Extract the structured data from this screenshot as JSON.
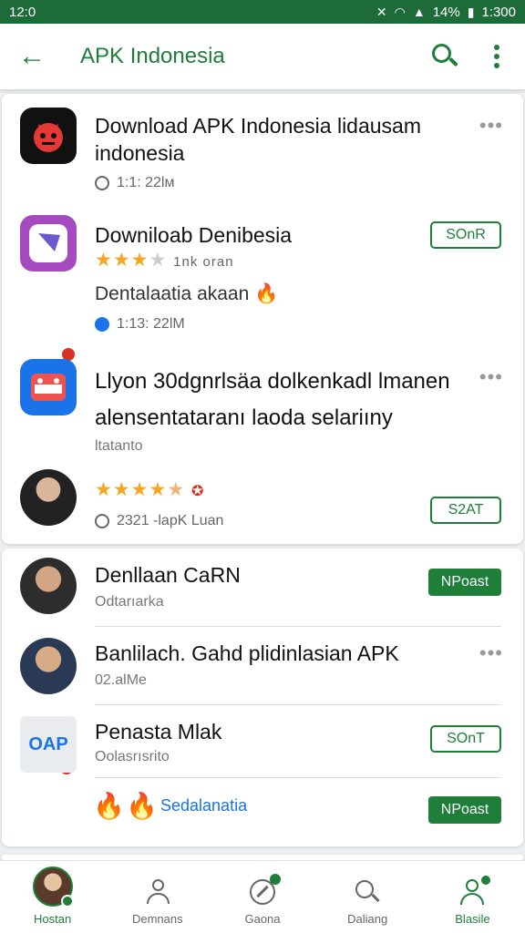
{
  "status_bar": {
    "time": "12:0",
    "battery": "14%",
    "clock_right": "1:300"
  },
  "app_bar": {
    "title": "APK Indonesia"
  },
  "card1": {
    "items": [
      {
        "title": "Download APK Indonesia lidausam indonesia",
        "meta": "1:1:  22lм"
      },
      {
        "title": "Downiloab Denibesia",
        "rating_text": "1nk oran",
        "description": "Dentalaatia akaan",
        "meta": "1:13:  22lM",
        "button": "SOnR"
      },
      {
        "title": "Llyon 30dgnrlsäa dolkenkadl lmanen alensentataranı laoda selariıny",
        "sub": "ltatanto"
      },
      {
        "meta": "2321 -lapK Luan",
        "button": "S2AT"
      }
    ]
  },
  "card2": {
    "items": [
      {
        "title": "Denllaan CaRN",
        "sub": "Odtarıarka",
        "button": "NPoast"
      },
      {
        "title": "Banlilach. Gahd plidinlasian APK",
        "sub": "02.alMe"
      },
      {
        "title": "Penasta Mlak",
        "sub": "Oolasrısrito",
        "icon_text": "OAP",
        "button": "SOnT"
      },
      {
        "label": "Sedalanatia",
        "button": "NPoast"
      }
    ]
  },
  "bottom_nav": [
    {
      "label": "Hostan"
    },
    {
      "label": "Demnans"
    },
    {
      "label": "Gaona"
    },
    {
      "label": "Daliang"
    },
    {
      "label": "Blasile"
    }
  ],
  "colors": {
    "brand_green": "#1e7e3a",
    "status_bar": "#1e6b3a",
    "star": "#f5a623"
  }
}
